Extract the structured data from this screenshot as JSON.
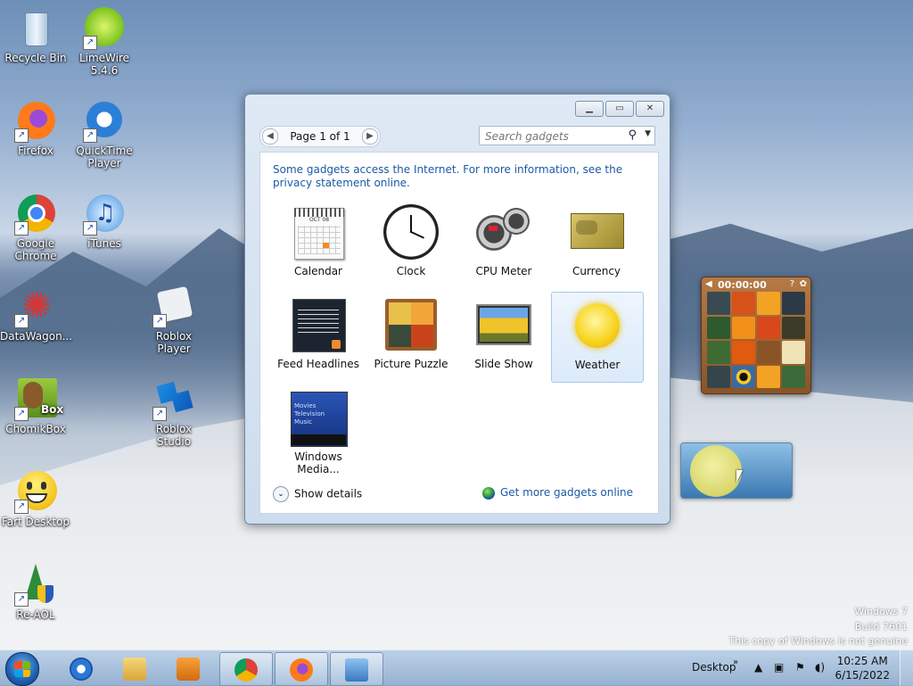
{
  "desktop_icons": [
    {
      "id": "recycle-bin",
      "label": "Recycle Bin",
      "icon": "recycle-bin-icon"
    },
    {
      "id": "limewire",
      "label": "LimeWire 5.4.6",
      "icon": "limewire-icon"
    },
    {
      "id": "firefox",
      "label": "Firefox",
      "icon": "firefox-icon"
    },
    {
      "id": "quicktime",
      "label": "QuickTime Player",
      "icon": "quicktime-icon"
    },
    {
      "id": "chrome",
      "label": "Google Chrome",
      "icon": "chrome-icon"
    },
    {
      "id": "itunes",
      "label": "iTunes",
      "icon": "itunes-icon"
    },
    {
      "id": "datawagon",
      "label": "DataWagon...",
      "icon": "datawagon-icon"
    },
    {
      "id": "roblox-player",
      "label": "Roblox Player",
      "icon": "roblox-player-icon"
    },
    {
      "id": "chomikbox",
      "label": "ChomikBox",
      "icon": "chomikbox-icon"
    },
    {
      "id": "roblox-studio",
      "label": "Roblox Studio",
      "icon": "roblox-studio-icon"
    },
    {
      "id": "fart-desktop",
      "label": "Fart Desktop",
      "icon": "smiley-icon"
    },
    {
      "id": "re-aol",
      "label": "Re-AOL",
      "icon": "re-aol-icon"
    }
  ],
  "chomikbox_badge": "Box",
  "gadgets_window": {
    "pager": "Page 1 of 1",
    "search_placeholder": "Search gadgets",
    "info_text": "Some gadgets access the Internet.  For more information, see the privacy statement online.",
    "gadgets": [
      {
        "label": "Calendar",
        "icon": "calendar-icon",
        "calendar_month": "OCT 08"
      },
      {
        "label": "Clock",
        "icon": "clock-icon"
      },
      {
        "label": "CPU Meter",
        "icon": "cpu-meter-icon"
      },
      {
        "label": "Currency",
        "icon": "currency-icon"
      },
      {
        "label": "Feed Headlines",
        "icon": "feed-headlines-icon"
      },
      {
        "label": "Picture Puzzle",
        "icon": "picture-puzzle-icon"
      },
      {
        "label": "Slide Show",
        "icon": "slide-show-icon"
      },
      {
        "label": "Weather",
        "icon": "weather-icon",
        "selected": true
      },
      {
        "label": "Windows Media...",
        "icon": "windows-media-icon"
      }
    ],
    "media_menu": [
      "Movies",
      "Television",
      "Music"
    ],
    "show_details": "Show details",
    "get_more": "Get more gadgets online"
  },
  "puzzle_gadget": {
    "timer": "00:00:00"
  },
  "watermark": {
    "line1": "Windows 7",
    "line2": "Build 7601",
    "line3": "This copy of Windows is not genuine"
  },
  "taskbar": {
    "pinned": [
      "internet-explorer-icon",
      "file-explorer-icon",
      "media-player-icon",
      "chrome-icon",
      "firefox-icon",
      "gadgets-icon"
    ],
    "desktop_label": "Desktop",
    "time": "10:25 AM",
    "date": "6/15/2022"
  },
  "colors": {
    "link": "#1b5aa6",
    "window_border": "#6f8aa8",
    "selection": "#dbeafa"
  }
}
